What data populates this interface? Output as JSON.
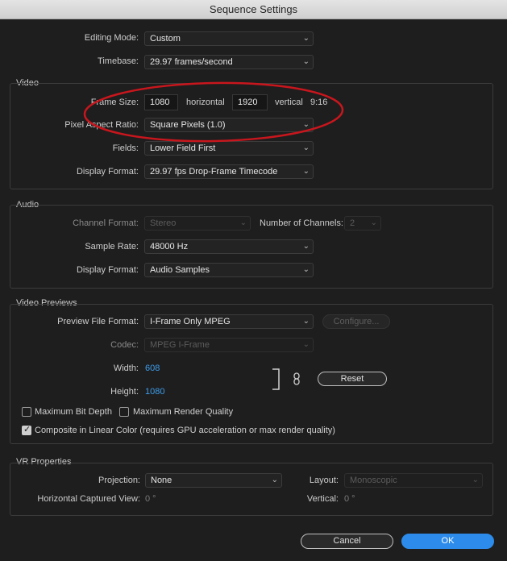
{
  "window": {
    "title": "Sequence Settings"
  },
  "general": {
    "editing_mode_label": "Editing Mode:",
    "editing_mode_value": "Custom",
    "timebase_label": "Timebase:",
    "timebase_value": "29.97  frames/second"
  },
  "video": {
    "title": "Video",
    "frame_size_label": "Frame Size:",
    "frame_width": "1080",
    "horizontal_label": "horizontal",
    "frame_height": "1920",
    "vertical_label": "vertical",
    "aspect_ratio": "9:16",
    "pixel_aspect_label": "Pixel Aspect Ratio:",
    "pixel_aspect_value": "Square Pixels (1.0)",
    "fields_label": "Fields:",
    "fields_value": "Lower Field First",
    "display_format_label": "Display Format:",
    "display_format_value": "29.97 fps Drop-Frame Timecode"
  },
  "audio": {
    "title": "Audio",
    "channel_format_label": "Channel Format:",
    "channel_format_value": "Stereo",
    "num_channels_label": "Number of Channels:",
    "num_channels_value": "2",
    "sample_rate_label": "Sample Rate:",
    "sample_rate_value": "48000 Hz",
    "display_format_label": "Display Format:",
    "display_format_value": "Audio Samples"
  },
  "previews": {
    "title": "Video Previews",
    "file_format_label": "Preview File Format:",
    "file_format_value": "I-Frame Only MPEG",
    "configure_label": "Configure...",
    "codec_label": "Codec:",
    "codec_value": "MPEG I-Frame",
    "width_label": "Width:",
    "width_value": "608",
    "height_label": "Height:",
    "height_value": "1080",
    "reset_label": "Reset",
    "max_bit_depth_label": "Maximum Bit Depth",
    "max_render_quality_label": "Maximum Render Quality",
    "linear_color_label": "Composite in Linear Color (requires GPU acceleration or max render quality)"
  },
  "vr": {
    "title": "VR Properties",
    "projection_label": "Projection:",
    "projection_value": "None",
    "layout_label": "Layout:",
    "layout_value": "Monoscopic",
    "h_view_label": "Horizontal Captured View:",
    "h_view_value": "0 °",
    "vertical_label": "Vertical:",
    "vertical_value": "0 °"
  },
  "footer": {
    "cancel_label": "Cancel",
    "ok_label": "OK"
  },
  "colors": {
    "annotation": "#c8161d",
    "accent": "#2d8ceb",
    "link_value": "#3d9dea"
  }
}
